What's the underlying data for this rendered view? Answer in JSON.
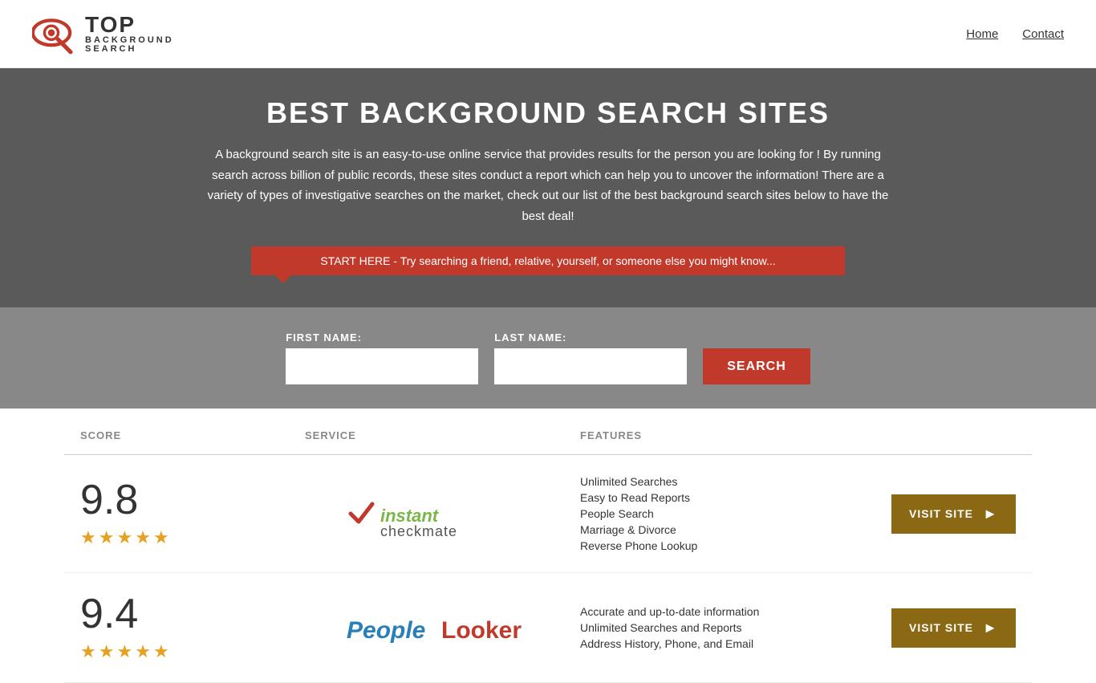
{
  "header": {
    "logo_top": "TOP",
    "logo_bottom": "BACKGROUND\nSEARCH",
    "nav": [
      {
        "label": "Home",
        "href": "#"
      },
      {
        "label": "Contact",
        "href": "#"
      }
    ]
  },
  "hero": {
    "title": "BEST BACKGROUND SEARCH SITES",
    "description": "A background search site is an easy-to-use online service that provides results  for the person you are looking for ! By  running  search across billion of public records, these sites conduct  a report which can help you to uncover the information! There are a variety of types of investigative searches on the market, check out our  list of the best background search sites below to have the best deal!",
    "callout": "START HERE - Try searching a friend, relative, yourself, or someone else you might know...",
    "form": {
      "first_name_label": "FIRST NAME:",
      "last_name_label": "LAST NAME:",
      "search_button": "SEARCH"
    }
  },
  "table": {
    "columns": [
      "SCORE",
      "SERVICE",
      "FEATURES",
      ""
    ],
    "rows": [
      {
        "score": "9.8",
        "stars": 4.5,
        "service_name": "Instant Checkmate",
        "features": [
          "Unlimited Searches",
          "Easy to Read Reports",
          "People Search",
          "Marriage & Divorce",
          "Reverse Phone Lookup"
        ],
        "visit_label": "VISIT SITE"
      },
      {
        "score": "9.4",
        "stars": 4.5,
        "service_name": "PeopleLooker",
        "features": [
          "Accurate and up-to-date information",
          "Unlimited Searches and Reports",
          "Address History, Phone, and Email"
        ],
        "visit_label": "VISIT SITE"
      }
    ]
  }
}
